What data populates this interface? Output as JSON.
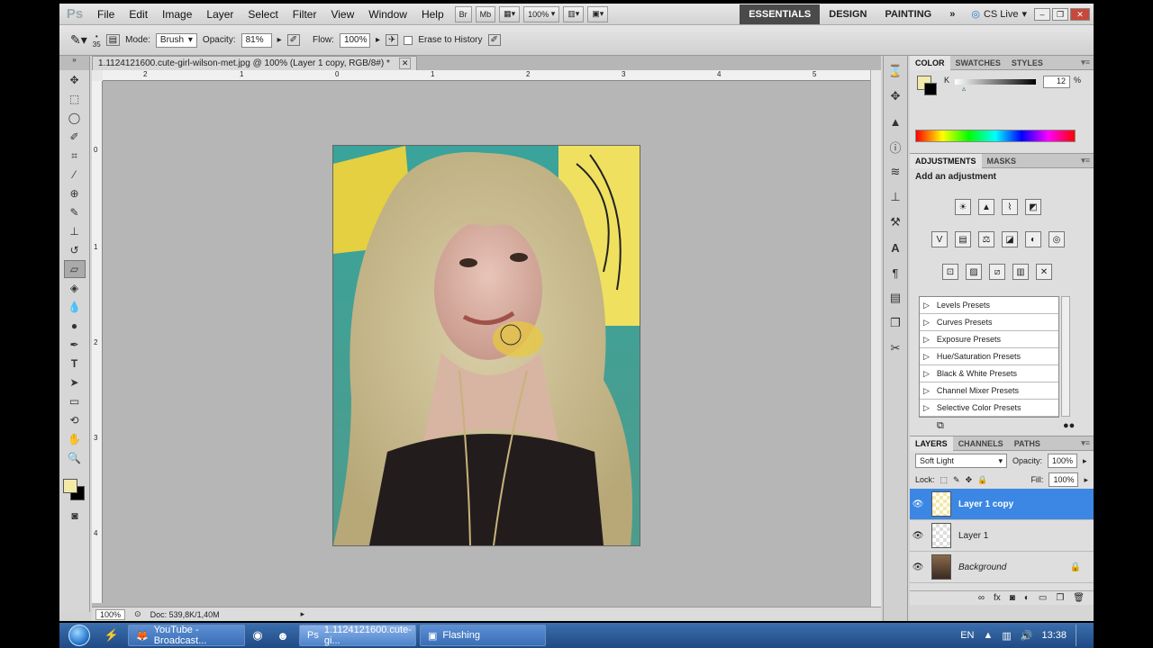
{
  "menubar": {
    "logo": "Ps",
    "items": [
      "File",
      "Edit",
      "Image",
      "Layer",
      "Select",
      "Filter",
      "View",
      "Window",
      "Help"
    ],
    "zoom": "100%",
    "workspaces": [
      "ESSENTIALS",
      "DESIGN",
      "PAINTING"
    ],
    "cs_live": "CS Live"
  },
  "options": {
    "brush_size": "35",
    "mode_label": "Mode:",
    "mode_value": "Brush",
    "opacity_label": "Opacity:",
    "opacity_value": "81%",
    "flow_label": "Flow:",
    "flow_value": "100%",
    "erase_history": "Erase to History"
  },
  "document": {
    "tab_title": "1.1124121600.cute-girl-wilson-met.jpg @ 100% (Layer 1 copy, RGB/8#) *",
    "zoom": "100%",
    "doc_size": "Doc: 539,8K/1,40M",
    "ruler_h": [
      "2",
      "1",
      "0",
      "1",
      "2",
      "3",
      "4",
      "5"
    ],
    "ruler_v": [
      "0",
      "1",
      "2",
      "3",
      "4"
    ]
  },
  "color_panel": {
    "tabs": [
      "COLOR",
      "SWATCHES",
      "STYLES"
    ],
    "channel": "K",
    "value": "12",
    "unit": "%",
    "fg_color": "#f3e9a8"
  },
  "adjustments": {
    "tabs": [
      "ADJUSTMENTS",
      "MASKS"
    ],
    "heading": "Add an adjustment",
    "presets": [
      "Levels Presets",
      "Curves Presets",
      "Exposure Presets",
      "Hue/Saturation Presets",
      "Black & White Presets",
      "Channel Mixer Presets",
      "Selective Color Presets"
    ]
  },
  "layers_panel": {
    "tabs": [
      "LAYERS",
      "CHANNELS",
      "PATHS"
    ],
    "blend_mode": "Soft Light",
    "opacity_label": "Opacity:",
    "opacity_value": "100%",
    "lock_label": "Lock:",
    "fill_label": "Fill:",
    "fill_value": "100%",
    "layers": [
      "Layer 1 copy",
      "Layer 1",
      "Background"
    ]
  },
  "taskbar": {
    "tasks": [
      "YouTube - Broadcast...",
      "1.1124121600.cute-gi...",
      "Flashing"
    ],
    "lang": "EN",
    "time": "13:38"
  }
}
